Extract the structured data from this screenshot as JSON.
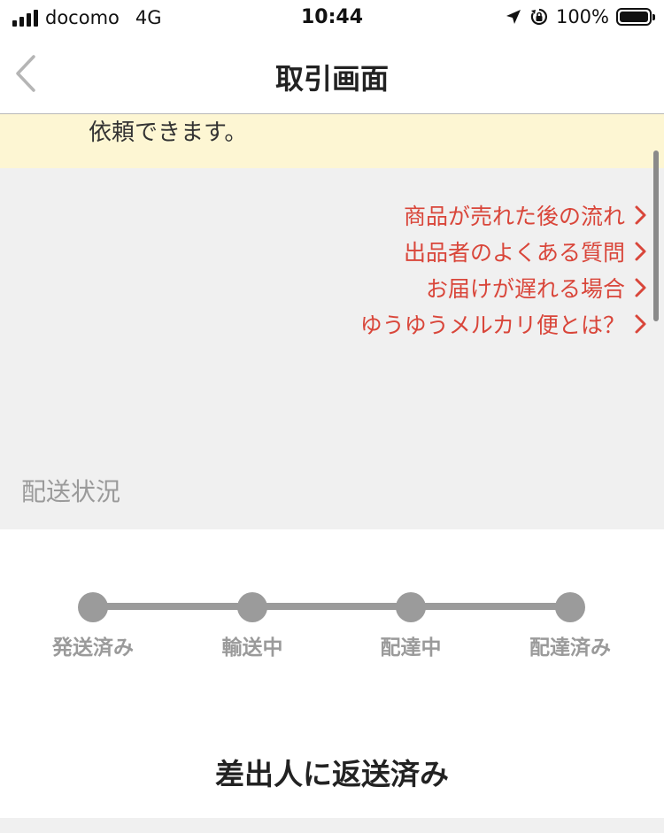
{
  "status_bar": {
    "carrier": "docomo",
    "network": "4G",
    "time": "10:44",
    "battery_percent": "100%",
    "icons": [
      "signal-icon",
      "location-arrow-icon",
      "rotation-lock-icon",
      "battery-icon"
    ]
  },
  "nav": {
    "title": "取引画面",
    "back_icon": "chevron-left-icon"
  },
  "notice": {
    "text": "依頼できます。"
  },
  "links": [
    {
      "label": "商品が売れた後の流れ"
    },
    {
      "label": "出品者のよくある質問"
    },
    {
      "label": "お届けが遅れる場合"
    },
    {
      "label": "ゆうゆうメルカリ便とは？"
    }
  ],
  "shipping": {
    "section_label": "配送状況",
    "steps": [
      {
        "label": "発送済み"
      },
      {
        "label": "輸送中"
      },
      {
        "label": "配達中"
      },
      {
        "label": "配達済み"
      }
    ],
    "status_result": "差出人に返送済み"
  },
  "colors": {
    "link_red": "#d9463a",
    "notice_yellow": "#fdf6d3",
    "track_gray": "#9b9b9b",
    "background_gray": "#f0f0f0"
  }
}
